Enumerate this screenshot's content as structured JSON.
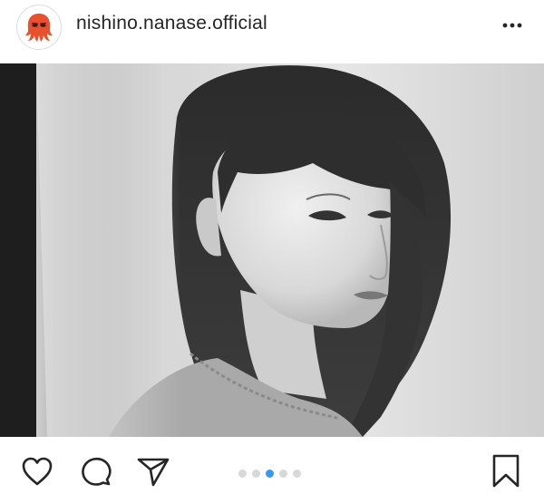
{
  "post": {
    "username": "nishino.nanase.official",
    "avatar_icon": "red-octopus-icon",
    "more_icon": "ellipsis-icon"
  },
  "photo": {
    "description_icon": "black-and-white-portrait"
  },
  "actions": {
    "like_icon": "heart-icon",
    "comment_icon": "comment-bubble-icon",
    "share_icon": "paper-plane-icon",
    "save_icon": "bookmark-icon"
  },
  "carousel": {
    "total": 5,
    "current": 3,
    "active_color": "#3897f0",
    "inactive_color": "#d8d8d8"
  },
  "colors": {
    "text": "#262626",
    "avatar_accent": "#e8502e"
  }
}
